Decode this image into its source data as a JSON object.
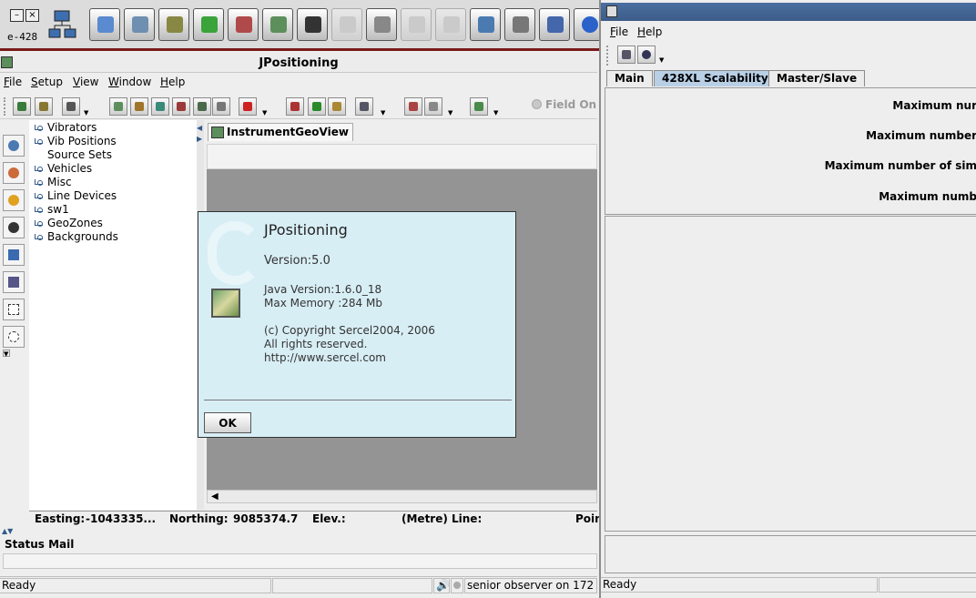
{
  "launcher": {
    "label": "e-428",
    "minimize": "–",
    "close": "×",
    "icons": [
      {
        "name": "network-icon",
        "color": "#3d6fb0"
      },
      {
        "name": "probe-icon",
        "color": "#5a8ad0"
      },
      {
        "name": "config-icon",
        "color": "#6f8fb0"
      },
      {
        "name": "gears-icon",
        "color": "#888844"
      },
      {
        "name": "swap-icon",
        "color": "#3aa33a"
      },
      {
        "name": "tools-icon",
        "color": "#b04a4a"
      },
      {
        "name": "map-icon",
        "color": "#5c8f5c"
      },
      {
        "name": "box-icon",
        "color": "#333333"
      },
      {
        "name": "doc-icon",
        "color": "#aaaaaa",
        "disabled": true
      },
      {
        "name": "printer-icon",
        "color": "#888888"
      },
      {
        "name": "truck-icon",
        "color": "#aaaaaa",
        "disabled": true
      },
      {
        "name": "qvc-icon",
        "color": "#aaaaaa",
        "disabled": true
      },
      {
        "name": "pen-icon",
        "color": "#4a7ab0"
      },
      {
        "name": "gauge-icon",
        "color": "#777777"
      },
      {
        "name": "hif-icon",
        "color": "#4466aa"
      },
      {
        "name": "help-icon",
        "color": "#2a62c9"
      }
    ]
  },
  "main": {
    "title": "JPositioning",
    "menu": [
      {
        "first": "F",
        "rest": "ile"
      },
      {
        "first": "S",
        "rest": "etup"
      },
      {
        "first": "V",
        "rest": "iew"
      },
      {
        "first": "W",
        "rest": "indow"
      },
      {
        "first": "H",
        "rest": "elp"
      }
    ],
    "field_on": "Field On",
    "tree": [
      "Vibrators",
      "Vib Positions",
      "Source Sets",
      "Vehicles",
      "Misc",
      "Line Devices",
      "sw1",
      "GeoZones",
      "Backgrounds"
    ],
    "doc_tab": {
      "label": "InstrumentGeoView",
      "close": "×"
    },
    "scroll_left": "◀",
    "coords": {
      "easting_label": "Easting:",
      "easting_value": "-1043335...",
      "northing_label": "Northing:",
      "northing_value": "9085374.7",
      "elev_label": "Elev.:",
      "unit": "(Metre)",
      "line_label": "Line:",
      "point_label": "Poin"
    },
    "status_mail": "Status Mail",
    "status": {
      "ready": "Ready",
      "user": "senior observer on 172"
    }
  },
  "about": {
    "title": "JPositioning",
    "version": "Version:5.0",
    "java_version": "Java Version:1.6.0_18",
    "max_memory": "Max Memory :284 Mb",
    "copyright": "(c) Copyright Sercel2004, 2006",
    "rights": "All rights reserved.",
    "url": "http://www.sercel.com",
    "ok": "OK"
  },
  "right": {
    "menu": [
      {
        "first": "F",
        "rest": "ile"
      },
      {
        "first": "H",
        "rest": "elp"
      }
    ],
    "tabs": [
      "Main",
      "428XL Scalability",
      "Master/Slave"
    ],
    "labels": [
      "Maximum nur",
      "Maximum number",
      "Maximum number of sim",
      "Maximum numb"
    ],
    "status": "Ready"
  },
  "colors": {
    "dialog_bg": "#d8eef5",
    "active_tab": "#b8cfe6",
    "map_canvas": "#949494",
    "accent_border": "#7a1b1b"
  }
}
